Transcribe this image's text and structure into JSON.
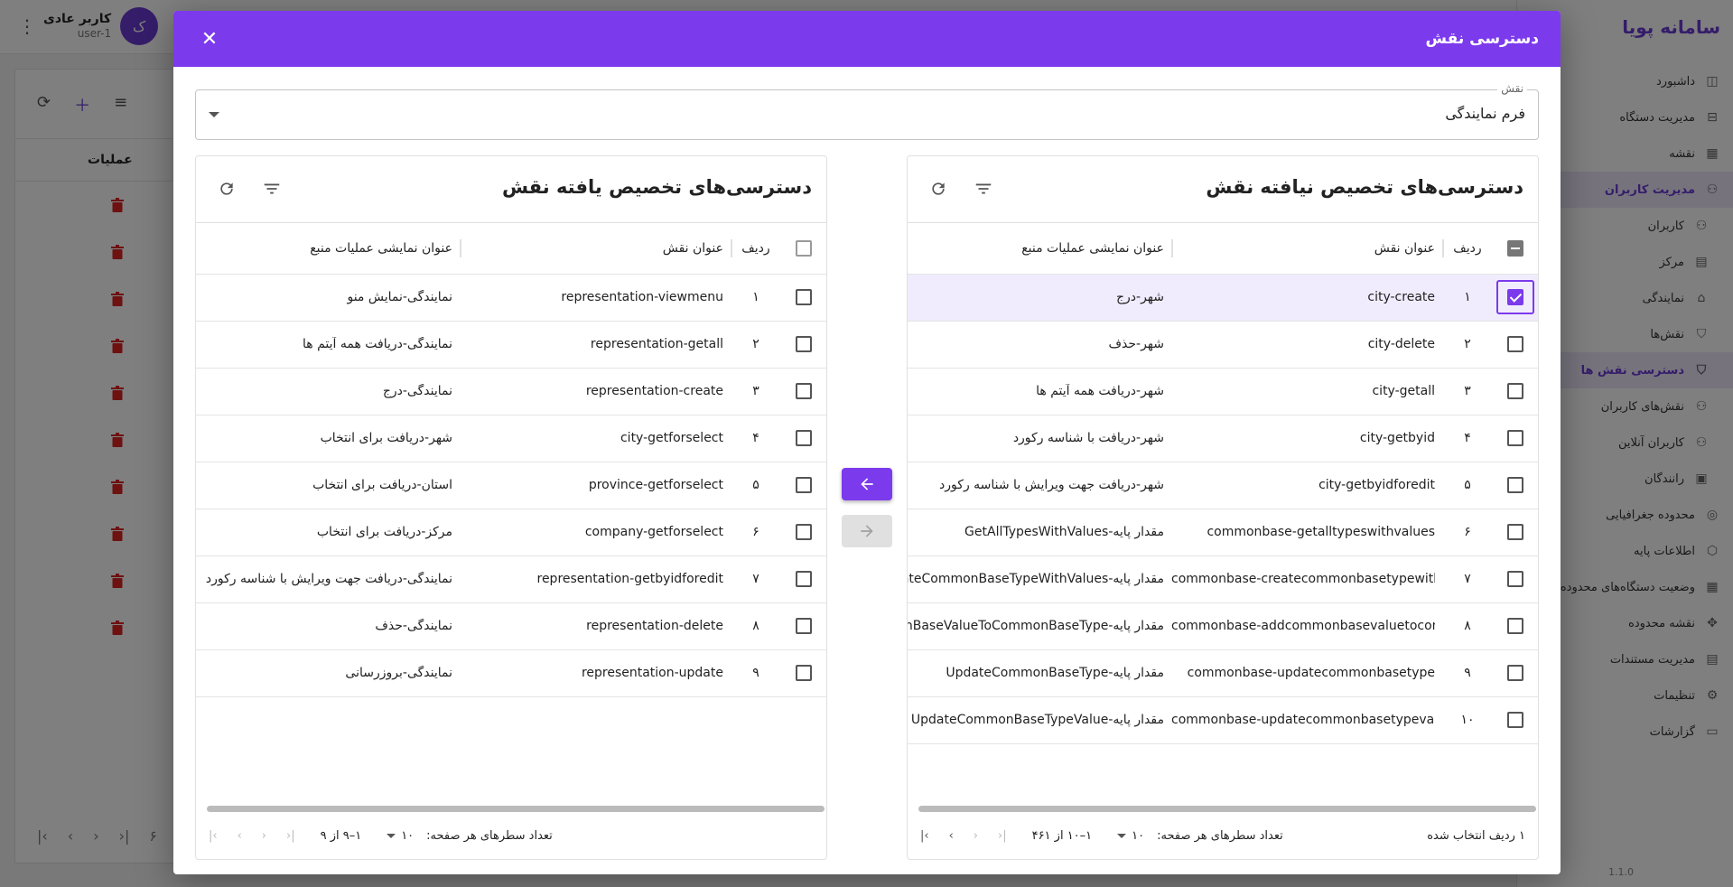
{
  "background": {
    "user_name": "کاربر عادی",
    "user_id": "user-1",
    "avatar_letter": "ک",
    "ops_header": "عملیات",
    "brand": "سامانه پویا",
    "version": "1.1.0",
    "pager_partial": "۶",
    "nav": [
      {
        "label": "داشبورد",
        "icon": "dashboard-icon",
        "glyph": "◫",
        "sub": false,
        "active": false
      },
      {
        "label": "مدیریت دستگاه",
        "icon": "device-icon",
        "glyph": "⊟",
        "sub": false,
        "active": false
      },
      {
        "label": "نقشه",
        "icon": "map-icon",
        "glyph": "▦",
        "sub": false,
        "active": false
      },
      {
        "label": "مدیریت کاربران",
        "icon": "users-icon",
        "glyph": "⚇",
        "sub": false,
        "active": true
      },
      {
        "label": "کاربران",
        "icon": "user-icon",
        "glyph": "⚇",
        "sub": true,
        "active": false
      },
      {
        "label": "مرکز",
        "icon": "center-icon",
        "glyph": "▤",
        "sub": true,
        "active": false
      },
      {
        "label": "نمایندگی",
        "icon": "store-icon",
        "glyph": "⌂",
        "sub": true,
        "active": false
      },
      {
        "label": "نقش‌ها",
        "icon": "shield-icon",
        "glyph": "⛉",
        "sub": true,
        "active": false
      },
      {
        "label": "دسترسی نقش ها",
        "icon": "shield-lock-icon",
        "glyph": "⛉",
        "sub": true,
        "active": true
      },
      {
        "label": "نقش‌های کاربران",
        "icon": "user-role-icon",
        "glyph": "⚇",
        "sub": true,
        "active": false
      },
      {
        "label": "کاربران آنلاین",
        "icon": "online-user-icon",
        "glyph": "⚇",
        "sub": true,
        "active": false
      },
      {
        "label": "رانندگان",
        "icon": "driver-icon",
        "glyph": "▣",
        "sub": true,
        "active": false
      },
      {
        "label": "محدوده جغرافیایی",
        "icon": "geo-icon",
        "glyph": "◎",
        "sub": false,
        "active": false
      },
      {
        "label": "اطلاعات پایه",
        "icon": "cube-icon",
        "glyph": "⬡",
        "sub": false,
        "active": false
      },
      {
        "label": "وضعیت دستگاه‌های محدوده",
        "icon": "status-icon",
        "glyph": "▦",
        "sub": false,
        "active": false
      },
      {
        "label": "نقشه محدوده",
        "icon": "map-area-icon",
        "glyph": "✥",
        "sub": false,
        "active": false
      },
      {
        "label": "مدیریت مستندات",
        "icon": "docs-icon",
        "glyph": "▤",
        "sub": false,
        "active": false
      },
      {
        "label": "تنظیمات",
        "icon": "gear-icon",
        "glyph": "⚙",
        "sub": false,
        "active": false
      },
      {
        "label": "گزارشات",
        "icon": "report-icon",
        "glyph": "▭",
        "sub": false,
        "active": false
      }
    ]
  },
  "modal": {
    "title": "دسترسی نقش",
    "role_label": "نقش",
    "role_value": "فرم نمایندگی"
  },
  "unassigned": {
    "title": "دسترسی‌های تخصیص نیافته نقش",
    "columns": {
      "index": "ردیف",
      "name": "عنوان نقش",
      "source": "عنوان نمایشی عملیات منبع"
    },
    "rows": [
      {
        "index": "۱",
        "name": "city-create",
        "source": "شهر-درج",
        "checked": true
      },
      {
        "index": "۲",
        "name": "city-delete",
        "source": "شهر-حذف",
        "checked": false
      },
      {
        "index": "۳",
        "name": "city-getall",
        "source": "شهر-دریافت همه آیتم ها",
        "checked": false
      },
      {
        "index": "۴",
        "name": "city-getbyid",
        "source": "شهر-دریافت با شناسه رکورد",
        "checked": false
      },
      {
        "index": "۵",
        "name": "city-getbyidforedit",
        "source": "شهر-دریافت جهت ویرایش با شناسه رکورد",
        "checked": false
      },
      {
        "index": "۶",
        "name": "commonbase-getalltypeswithvalues",
        "source": "مقدار پایه-GetAllTypesWithValues",
        "checked": false
      },
      {
        "index": "۷",
        "name": "commonbase-createcommonbasetypewithvalues",
        "source": "مقدار پایه-CreateCommonBaseTypeWithValues",
        "checked": false
      },
      {
        "index": "۸",
        "name": "commonbase-addcommonbasevaluetocommonbasetype",
        "source": "مقدار پایه-AddCommonBaseValueToCommonBaseType",
        "checked": false
      },
      {
        "index": "۹",
        "name": "commonbase-updatecommonbasetype",
        "source": "مقدار پایه-UpdateCommonBaseType",
        "checked": false
      },
      {
        "index": "۱۰",
        "name": "commonbase-updatecommonbasetypevalue",
        "source": "مقدار پایه-UpdateCommonBaseTypeValue",
        "checked": false
      }
    ],
    "footer": {
      "selected_text": "۱ ردیف انتخاب شده",
      "rows_per_page_label": "تعداد سطرهای هر صفحه:",
      "rows_per_page": "۱۰",
      "range": "۱–۱۰ از ۴۶۱"
    }
  },
  "assigned": {
    "title": "دسترسی‌های تخصیص یافته نقش",
    "columns": {
      "index": "ردیف",
      "name": "عنوان نقش",
      "source": "عنوان نمایشی عملیات منبع"
    },
    "rows": [
      {
        "index": "۱",
        "name": "representation-viewmenu",
        "source": "نمایندگی-نمایش منو",
        "checked": false
      },
      {
        "index": "۲",
        "name": "representation-getall",
        "source": "نمایندگی-دریافت همه آیتم ها",
        "checked": false
      },
      {
        "index": "۳",
        "name": "representation-create",
        "source": "نمایندگی-درج",
        "checked": false
      },
      {
        "index": "۴",
        "name": "city-getforselect",
        "source": "شهر-دریافت برای انتخاب",
        "checked": false
      },
      {
        "index": "۵",
        "name": "province-getforselect",
        "source": "استان-دریافت برای انتخاب",
        "checked": false
      },
      {
        "index": "۶",
        "name": "company-getforselect",
        "source": "مرکز-دریافت برای انتخاب",
        "checked": false
      },
      {
        "index": "۷",
        "name": "representation-getbyidforedit",
        "source": "نمایندگی-دریافت جهت ویرایش با شناسه رکورد",
        "checked": false
      },
      {
        "index": "۸",
        "name": "representation-delete",
        "source": "نمایندگی-حذف",
        "checked": false
      },
      {
        "index": "۹",
        "name": "representation-update",
        "source": "نمایندگی-بروزرسانی",
        "checked": false
      }
    ],
    "footer": {
      "rows_per_page_label": "تعداد سطرهای هر صفحه:",
      "rows_per_page": "۱۰",
      "range": "۱–۹ از ۹"
    }
  },
  "colors": {
    "accent": "#7c3aed",
    "danger": "#dd2222"
  }
}
